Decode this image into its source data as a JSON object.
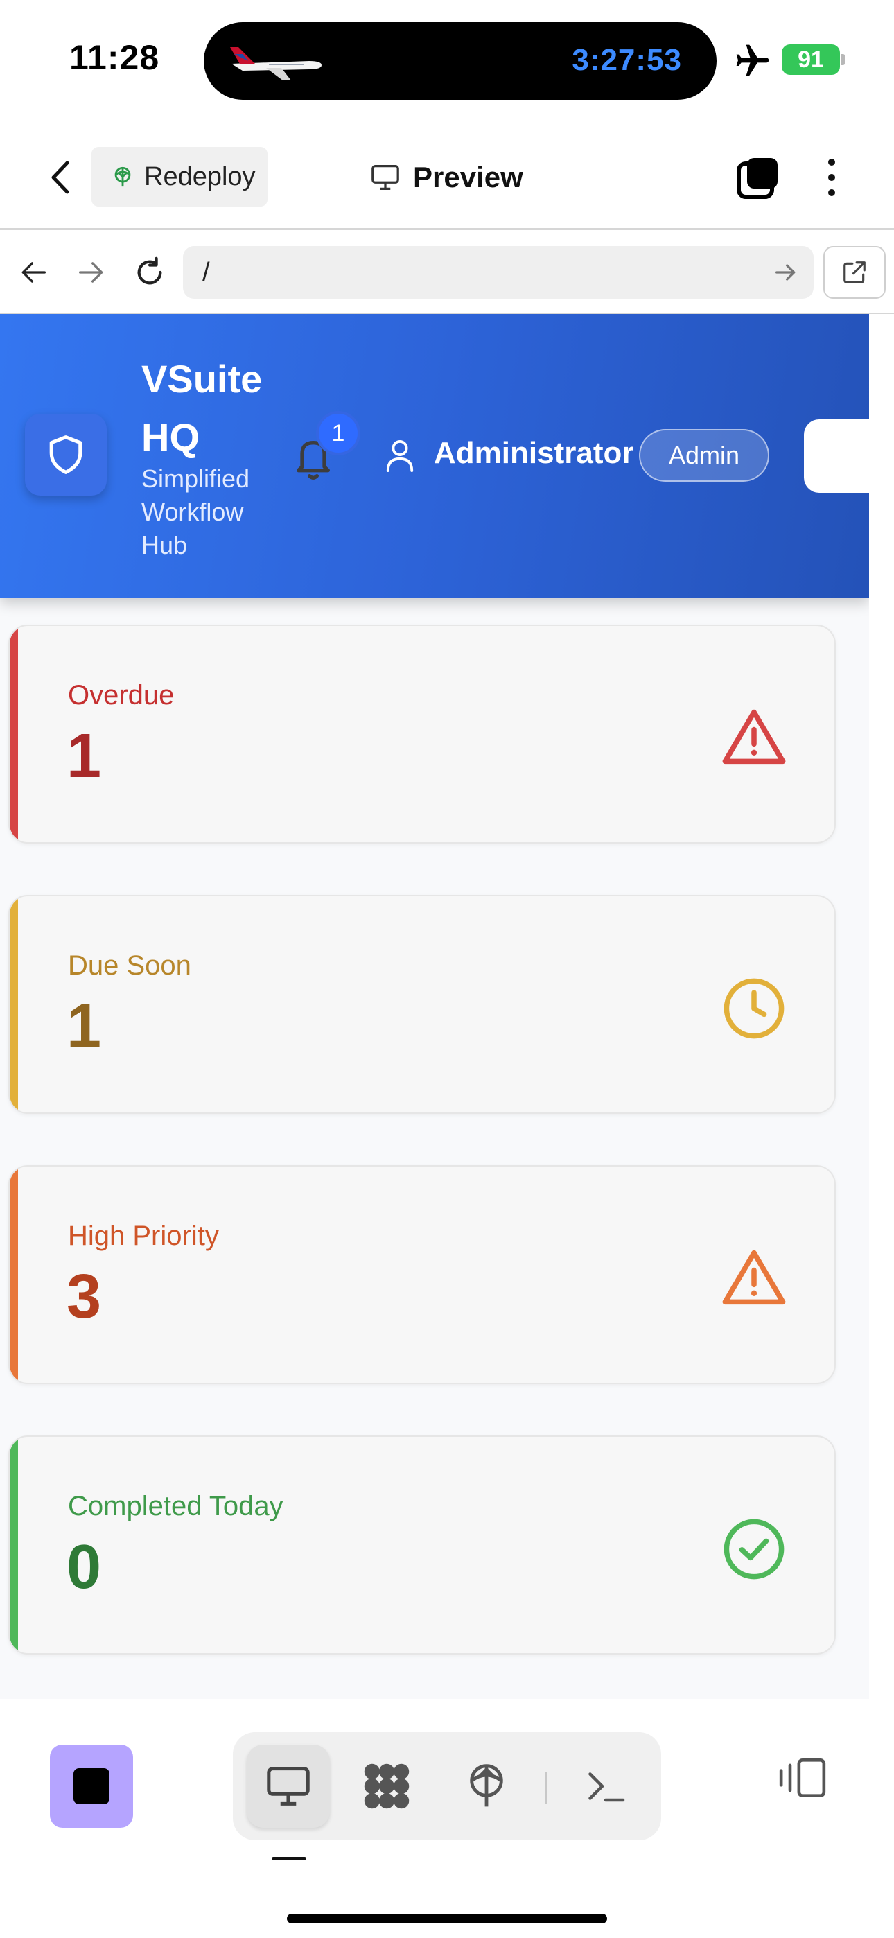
{
  "status_bar": {
    "time": "11:28",
    "live_activity_timer": "3:27:53",
    "battery": "91"
  },
  "app_bar": {
    "redeploy_label": "Redeploy",
    "preview_label": "Preview"
  },
  "browser": {
    "url": "/"
  },
  "header": {
    "title_line1": "VSuite",
    "title_line2": "HQ",
    "subtitle_line1": "Simplified",
    "subtitle_line2": "Workflow",
    "subtitle_line3": "Hub",
    "notification_count": "1",
    "user_name": "Administrator",
    "role_badge": "Admin"
  },
  "cards": [
    {
      "label": "Overdue",
      "value": "1",
      "icon": "alert-triangle-icon",
      "accent": "#d64545",
      "label_color": "#c53030",
      "value_color": "#a82a2a"
    },
    {
      "label": "Due Soon",
      "value": "1",
      "icon": "clock-icon",
      "accent": "#e2b03a",
      "label_color": "#b7862a",
      "value_color": "#8f6520"
    },
    {
      "label": "High Priority",
      "value": "3",
      "icon": "alert-triangle-icon",
      "accent": "#e8773a",
      "label_color": "#cf5528",
      "value_color": "#b4401f"
    },
    {
      "label": "Completed Today",
      "value": "0",
      "icon": "check-circle-icon",
      "accent": "#4fb85a",
      "label_color": "#3f9a4a",
      "value_color": "#2f7a37"
    }
  ],
  "colors": {
    "hero_start": "#3476f0",
    "hero_end": "#2452b8",
    "stop_button": "#b5a4ff",
    "battery_green": "#34c759"
  }
}
